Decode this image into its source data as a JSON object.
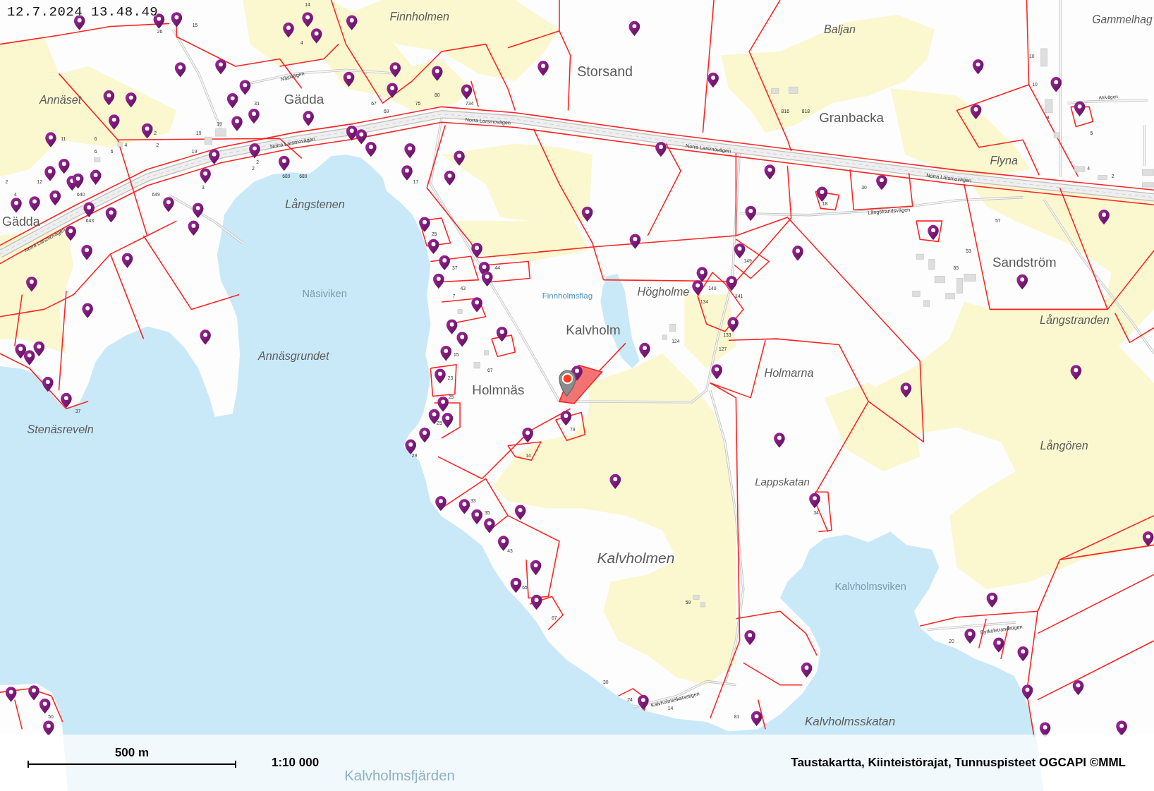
{
  "timestamp": "12.7.2024 13.48.49",
  "map": {
    "place_names": [
      {
        "text": "Finnholmen",
        "kind": "area"
      },
      {
        "text": "Gammelhag",
        "kind": "area"
      },
      {
        "text": "Baljan",
        "kind": "area"
      },
      {
        "text": "Storsand",
        "kind": "place"
      },
      {
        "text": "Annäset",
        "kind": "area"
      },
      {
        "text": "Gädda",
        "kind": "place"
      },
      {
        "text": "Granbacka",
        "kind": "place"
      },
      {
        "text": "Flyna",
        "kind": "area"
      },
      {
        "text": "Långstenen",
        "kind": "area"
      },
      {
        "text": "Gädda",
        "kind": "place"
      },
      {
        "text": "Sandström",
        "kind": "place"
      },
      {
        "text": "Högholme",
        "kind": "area"
      },
      {
        "text": "Kalvholm",
        "kind": "place"
      },
      {
        "text": "Långstranden",
        "kind": "area"
      },
      {
        "text": "Annäsgrundet",
        "kind": "area"
      },
      {
        "text": "Holmarna",
        "kind": "area"
      },
      {
        "text": "Holmnäs",
        "kind": "place"
      },
      {
        "text": "Stenäsreveln",
        "kind": "area"
      },
      {
        "text": "Långören",
        "kind": "area"
      },
      {
        "text": "Lappskatan",
        "kind": "area"
      },
      {
        "text": "Kalvholmen",
        "kind": "area"
      },
      {
        "text": "Kalvholmsskatan",
        "kind": "area"
      }
    ],
    "water_names": [
      {
        "text": "Näsiviken",
        "kind": "water"
      },
      {
        "text": "Finnholmsflag",
        "kind": "pond"
      },
      {
        "text": "Kalvholmsviken",
        "kind": "water"
      },
      {
        "text": "Kalvholmsfjärden",
        "kind": "water"
      }
    ],
    "road_names": [
      "Näsivägen",
      "Ahlvägen",
      "Norra Larsmovägen",
      "Norra Larsmovägen",
      "Norra Larsmovägen",
      "Norra Larsmovägen",
      "Långstrandsvägen",
      "Norra Larsmovägen",
      "Byrkölstrandstigen",
      "Kalvholmsskatastigen"
    ],
    "house_numbers": [
      "14",
      "15",
      "26",
      "4",
      "10",
      "10",
      "80",
      "31",
      "67",
      "75",
      "734",
      "69",
      "816",
      "818",
      "8",
      "19",
      "2",
      "19",
      "5",
      "11",
      "6",
      "4",
      "2",
      "6",
      "6",
      "19",
      "2",
      "2",
      "4",
      "689",
      "689",
      "2",
      "2",
      "12",
      "17",
      "3",
      "30",
      "4",
      "640",
      "649",
      "18",
      "643",
      "57",
      "25",
      "53",
      "149",
      "37",
      "44",
      "55",
      "43",
      "140",
      "7",
      "141",
      "134",
      "133",
      "124",
      "127",
      "15",
      "67",
      "23",
      "25",
      "37",
      "25",
      "79",
      "29",
      "14",
      "33",
      "35",
      "34",
      "43",
      "65",
      "59",
      "67",
      "20",
      "30",
      "24",
      "14",
      "50",
      "81"
    ]
  },
  "scale_bar": {
    "distance": "500 m",
    "ratio": "1:10 000"
  },
  "attribution": "Taustakartta, Kiinteistörajat, Tunnuspisteet OGCAPI ©MML"
}
